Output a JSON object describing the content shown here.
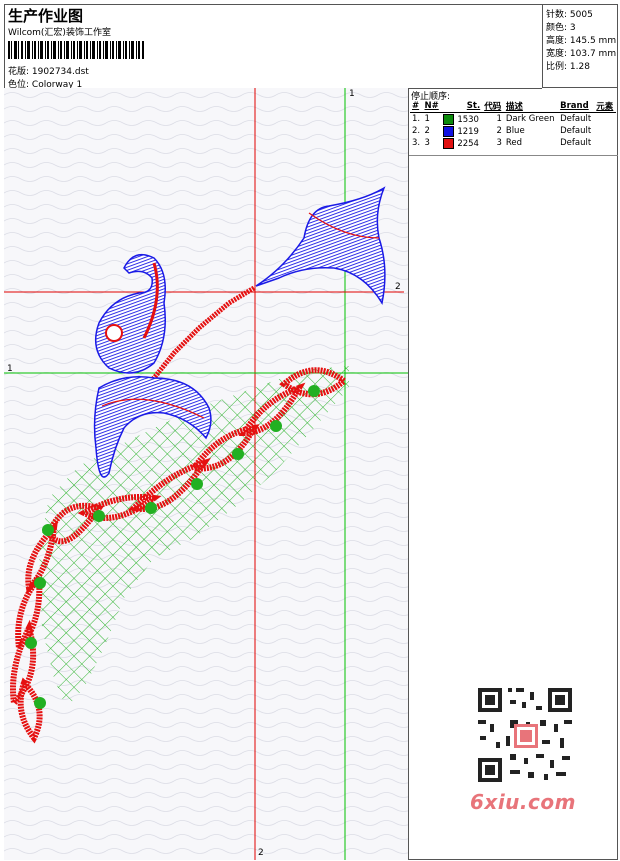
{
  "header": {
    "title": "生产作业图",
    "studio": "Wilcom(汇宏)装饰工作室",
    "design_label": "花版:",
    "design_value": "1902734.dst",
    "colorway_label": "色位:",
    "colorway_value": "Colorway 1"
  },
  "stats": [
    {
      "label": "针数:",
      "value": "5005"
    },
    {
      "label": "颜色:",
      "value": "3"
    },
    {
      "label": "高度:",
      "value": "145.5 mm"
    },
    {
      "label": "宽度:",
      "value": "103.7 mm"
    },
    {
      "label": "比例:",
      "value": "1.28"
    }
  ],
  "stop_sequence": {
    "title": "停止顺序:",
    "headers": [
      "#",
      "N#",
      "St.",
      "代码",
      "描述",
      "Brand",
      "元素"
    ],
    "rows": [
      {
        "idx": "1.",
        "n": "1",
        "color": "#0b8a0b",
        "st": "1530",
        "code": "1",
        "desc": "Dark Green",
        "brand": "Default"
      },
      {
        "idx": "2.",
        "n": "2",
        "color": "#1010e0",
        "st": "1219",
        "code": "2",
        "desc": "Blue",
        "brand": "Default"
      },
      {
        "idx": "3.",
        "n": "3",
        "color": "#e01010",
        "st": "2254",
        "code": "3",
        "desc": "Red",
        "brand": "Default"
      }
    ]
  },
  "guides": {
    "v1": "1",
    "v2": "2",
    "h1": "1",
    "h2": "2"
  },
  "watermark": "6xiu.com",
  "colors": {
    "green": "#22b022",
    "blue": "#1a1ae6",
    "red": "#e51010",
    "guide_red": "#e00000",
    "guide_green": "#00c000"
  }
}
